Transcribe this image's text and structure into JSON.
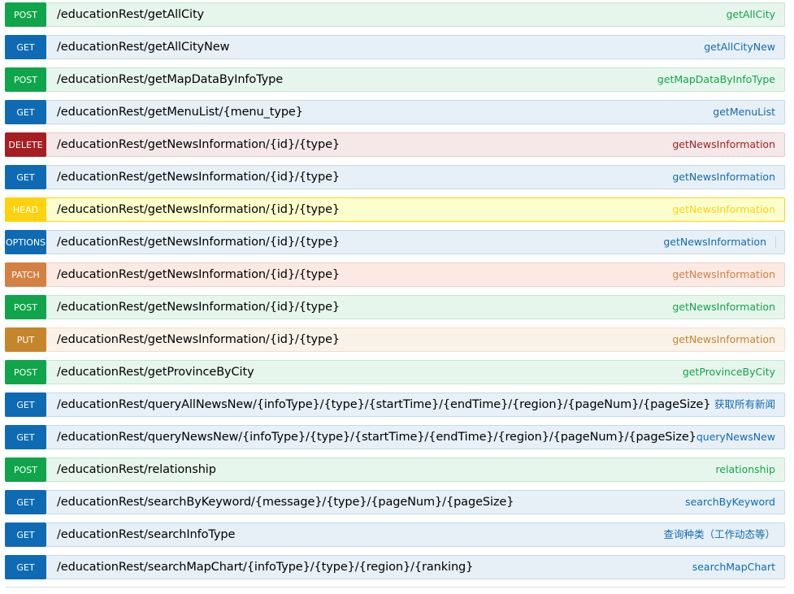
{
  "endpoints": [
    {
      "method": "POST",
      "path": "/educationRest/getAllCity",
      "summary": "getAllCity"
    },
    {
      "method": "GET",
      "path": "/educationRest/getAllCityNew",
      "summary": "getAllCityNew"
    },
    {
      "method": "POST",
      "path": "/educationRest/getMapDataByInfoType",
      "summary": "getMapDataByInfoType"
    },
    {
      "method": "GET",
      "path": "/educationRest/getMenuList/{menu_type}",
      "summary": "getMenuList"
    },
    {
      "method": "DELETE",
      "path": "/educationRest/getNewsInformation/{id}/{type}",
      "summary": "getNewsInformation"
    },
    {
      "method": "GET",
      "path": "/educationRest/getNewsInformation/{id}/{type}",
      "summary": "getNewsInformation"
    },
    {
      "method": "HEAD",
      "path": "/educationRest/getNewsInformation/{id}/{type}",
      "summary": "getNewsInformation"
    },
    {
      "method": "OPTIONS",
      "path": "/educationRest/getNewsInformation/{id}/{type}",
      "summary": "getNewsInformation"
    },
    {
      "method": "PATCH",
      "path": "/educationRest/getNewsInformation/{id}/{type}",
      "summary": "getNewsInformation"
    },
    {
      "method": "POST",
      "path": "/educationRest/getNewsInformation/{id}/{type}",
      "summary": "getNewsInformation"
    },
    {
      "method": "PUT",
      "path": "/educationRest/getNewsInformation/{id}/{type}",
      "summary": "getNewsInformation"
    },
    {
      "method": "POST",
      "path": "/educationRest/getProvinceByCity",
      "summary": "getProvinceByCity"
    },
    {
      "method": "GET",
      "path": "/educationRest/queryAllNewsNew/{infoType}/{type}/{startTime}/{endTime}/{region}/{pageNum}/{pageSize}",
      "summary": "获取所有新闻"
    },
    {
      "method": "GET",
      "path": "/educationRest/queryNewsNew/{infoType}/{type}/{startTime}/{endTime}/{region}/{pageNum}/{pageSize}",
      "summary": "queryNewsNew"
    },
    {
      "method": "POST",
      "path": "/educationRest/relationship",
      "summary": "relationship"
    },
    {
      "method": "GET",
      "path": "/educationRest/searchByKeyword/{message}/{type}/{pageNum}/{pageSize}",
      "summary": "searchByKeyword"
    },
    {
      "method": "GET",
      "path": "/educationRest/searchInfoType",
      "summary": "查询种类（工作动态等）"
    },
    {
      "method": "GET",
      "path": "/educationRest/searchMapChart/{infoType}/{type}/{region}/{ranking}",
      "summary": "searchMapChart"
    }
  ],
  "colors": {
    "POST": {
      "badge": "#10a54a",
      "bg": "#e7f6ec",
      "border": "#c3e8d1",
      "summary": "#10a54a"
    },
    "GET": {
      "badge": "#0f6ab4",
      "bg": "#e7f0f7",
      "border": "#c3d9ec",
      "summary": "#0f6ab4"
    },
    "DELETE": {
      "badge": "#a41e22",
      "bg": "#f5e8e8",
      "border": "#e8c6c7",
      "summary": "#a41e22"
    },
    "HEAD": {
      "badge": "#ffd20f",
      "bg": "#fcffcd",
      "border": "#ffd20f",
      "summary": "#ffd20f"
    },
    "OPTIONS": {
      "badge": "#0f6ab4",
      "bg": "#e7f0f7",
      "border": "#c3d9ec",
      "summary": "#0f6ab4"
    },
    "PATCH": {
      "badge": "#d38042",
      "bg": "#fce9e3",
      "border": "#f0cecb",
      "summary": "#d38042"
    },
    "PUT": {
      "badge": "#c5862b",
      "bg": "#f9f2e9",
      "border": "#f0e0ca",
      "summary": "#c5862b"
    }
  }
}
